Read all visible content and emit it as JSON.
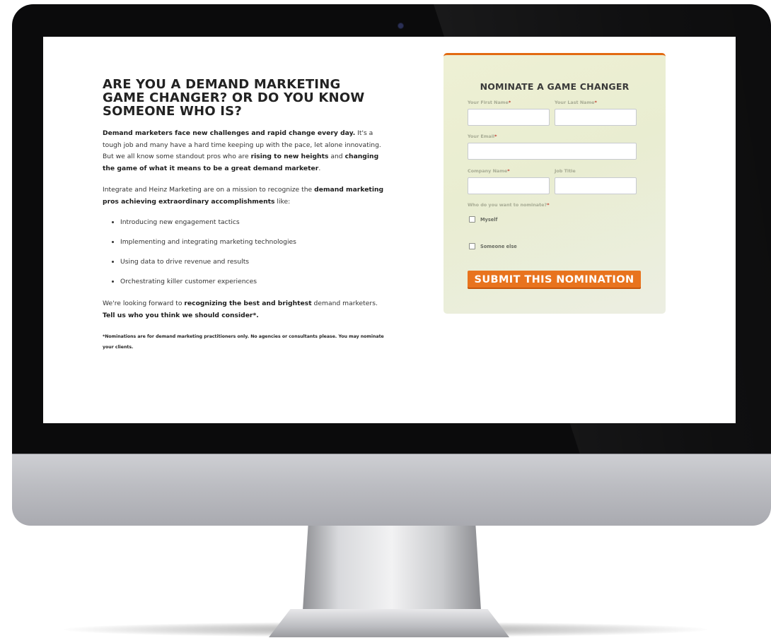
{
  "headline": "ARE YOU A DEMAND MARKETING GAME CHANGER? OR DO YOU KNOW SOMEONE WHO IS?",
  "intro": {
    "b1": "Demand marketers face new challenges and rapid change every day.",
    "t1": " It's a tough job and many have a hard time keeping up with the pace, let alone innovating. But we all know some standout pros who are ",
    "b2": "rising to new heights",
    "t2": " and ",
    "b3": "changing the game of what it means to be a great demand marketer",
    "t3": "."
  },
  "mission": {
    "t1": "Integrate and Heinz Marketing are on a mission to recognize the ",
    "b1": "demand marketing pros achieving extraordinary accomplishments",
    "t2": " like:"
  },
  "bullets": [
    "Introducing new engagement tactics",
    "Implementing and integrating marketing technologies",
    "Using data to drive revenue and results",
    "Orchestrating killer customer experiences"
  ],
  "closing": {
    "t1": "We're looking forward to ",
    "b1": "recognizing the best and brightest",
    "t2": " demand marketers. ",
    "b2": "Tell us who you think we should consider*."
  },
  "footnote": "*Nominations are for demand marketing practitioners only. No agencies or consultants please. You may nominate your clients.",
  "form": {
    "title": "NOMINATE A GAME CHANGER",
    "first_name_label": "Your First Name",
    "last_name_label": "Your Last Name",
    "email_label": "Your Email",
    "company_label": "Company Name",
    "job_title_label": "Job Title",
    "nominate_question": "Who do you want to nominate?",
    "required_mark": "*",
    "option_myself": "Myself",
    "option_someone_else": "Someone else",
    "submit_label": "SUBMIT THIS NOMINATION",
    "first_name_value": "",
    "last_name_value": "",
    "email_value": "",
    "company_value": "",
    "job_title_value": ""
  },
  "colors": {
    "accent": "#e8731e",
    "form_bg": "#eef0d4",
    "required": "#c0392b"
  }
}
